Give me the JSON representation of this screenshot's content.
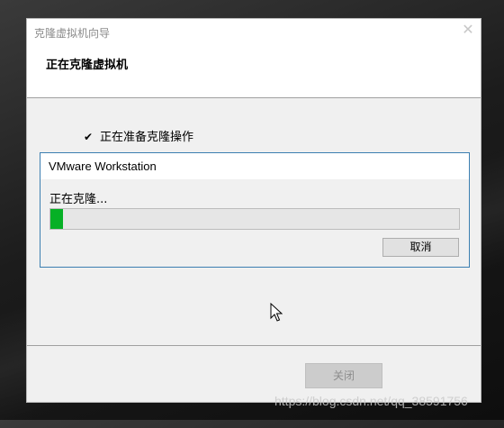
{
  "window": {
    "title": "克隆虚拟机向导",
    "close_glyph": "✕"
  },
  "header": {
    "page_title": "正在克隆虚拟机"
  },
  "steps": [
    {
      "icon": "check-icon",
      "glyph": "✔",
      "label": "正在准备克隆操作"
    }
  ],
  "progress_panel": {
    "title": "VMware Workstation",
    "status": "正在克隆...",
    "progress_fraction": 0.03,
    "progress_color": "#06b025",
    "cancel_label": "取消"
  },
  "footer": {
    "close_label": "关闭"
  },
  "watermark": "https://blog.csdn.net/qq_38591756"
}
